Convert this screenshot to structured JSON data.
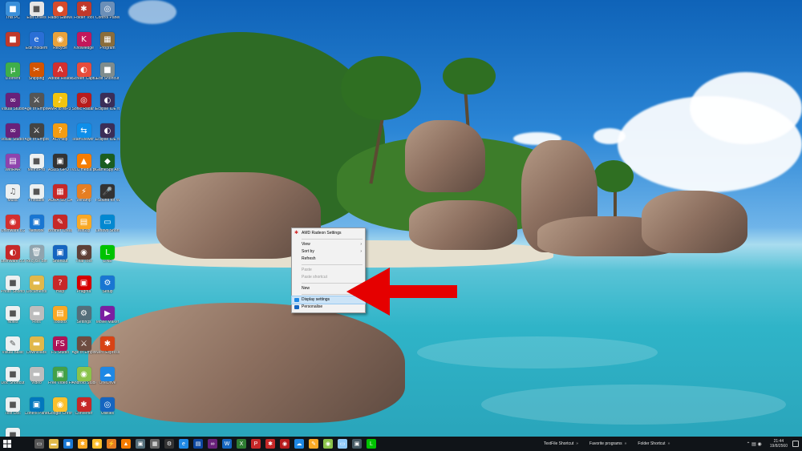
{
  "desktop": {
    "icons": [
      {
        "label": "This PC",
        "color": "#3a8fd9",
        "glyph": "■"
      },
      {
        "label": "Edit Drives",
        "color": "#e6e6e6",
        "glyph": "■"
      },
      {
        "label": "Radio Gateway",
        "color": "#d74b2c",
        "glyph": "●"
      },
      {
        "label": "Folder Tool",
        "color": "#c0392b",
        "glyph": "✱"
      },
      {
        "label": "Control Panel",
        "color": "#6b8fb8",
        "glyph": "◎"
      },
      {
        "label": "",
        "color": "#c0392b",
        "glyph": "■"
      },
      {
        "label": "Edit Holdem",
        "color": "#2a6fd6",
        "glyph": "e"
      },
      {
        "label": "Recycle",
        "color": "#e9a23b",
        "glyph": "◉"
      },
      {
        "label": "Knowledge",
        "color": "#c2185b",
        "glyph": "K"
      },
      {
        "label": "Program",
        "color": "#8a6d3b",
        "glyph": "▦"
      },
      {
        "label": "uTorrent",
        "color": "#3fae49",
        "glyph": "µ"
      },
      {
        "label": "Snipping",
        "color": "#d35400",
        "glyph": "✂"
      },
      {
        "label": "Adobe Reader XI",
        "color": "#d32f2f",
        "glyph": "A"
      },
      {
        "label": "Screen Capture",
        "color": "#e74c3c",
        "glyph": "◐"
      },
      {
        "label": "Edit Shortcut",
        "color": "#7f8c8d",
        "glyph": "■"
      },
      {
        "label": "Visual Studio",
        "color": "#68217a",
        "glyph": "∞"
      },
      {
        "label": "Age of Empires II",
        "color": "#555",
        "glyph": "⚔"
      },
      {
        "label": "AMR to MP3 Converter",
        "color": "#f1c40f",
        "glyph": "♪"
      },
      {
        "label": "Sonic Radar II",
        "color": "#b71c1c",
        "glyph": "◎"
      },
      {
        "label": "Eclipse IDE for Java",
        "color": "#3b2e58",
        "glyph": "◐"
      },
      {
        "label": "Visual Studio 2015",
        "color": "#68217a",
        "glyph": "∞"
      },
      {
        "label": "Age of Empires III",
        "color": "#444",
        "glyph": "⚔"
      },
      {
        "label": "AO Help",
        "color": "#f39c12",
        "glyph": "?"
      },
      {
        "label": "TeamViewer 12",
        "color": "#0e8ee9",
        "glyph": "⇆"
      },
      {
        "label": "Eclipse IDE for Java Dev",
        "color": "#3b2e58",
        "glyph": "◐"
      },
      {
        "label": "WinRAR",
        "color": "#8e44ad",
        "glyph": "▤"
      },
      {
        "label": "MemoPro",
        "color": "#ecf0f1",
        "glyph": "■"
      },
      {
        "label": "ASUS GPU Tweak",
        "color": "#333",
        "glyph": "▣"
      },
      {
        "label": "VLC media player",
        "color": "#f57c00",
        "glyph": "▲"
      },
      {
        "label": "GameSpy Arcade",
        "color": "#1b5e20",
        "glyph": "◆"
      },
      {
        "label": "Music",
        "color": "#ecf0f1",
        "glyph": "♫"
      },
      {
        "label": "Printable",
        "color": "#ecf0f1",
        "glyph": "■"
      },
      {
        "label": "AURA SD CARD",
        "color": "#c62828",
        "glyph": "▦"
      },
      {
        "label": "Winamp",
        "color": "#e67e22",
        "glyph": "⚡"
      },
      {
        "label": "i-Sound for Windows 7",
        "color": "#333",
        "glyph": "🎤"
      },
      {
        "label": "Unimware 8.2",
        "color": "#d32f2f",
        "glyph": "◉"
      },
      {
        "label": "Network",
        "color": "#1976d2",
        "glyph": "▣"
      },
      {
        "label": "Brother Creative",
        "color": "#c62828",
        "glyph": "✎"
      },
      {
        "label": "WinZip",
        "color": "#f9a825",
        "glyph": "▤"
      },
      {
        "label": "Lenovo Shortcut",
        "color": "#0288d1",
        "glyph": "▭"
      },
      {
        "label": "unimware 8.99 My Program",
        "color": "#c62828",
        "glyph": "◐"
      },
      {
        "label": "Recycle Bin",
        "color": "#90a4ae",
        "glyph": "🗑"
      },
      {
        "label": "Shortcut",
        "color": "#1565c0",
        "glyph": "▣"
      },
      {
        "label": "Thai Tool",
        "color": "#5d4037",
        "glyph": "◉"
      },
      {
        "label": "LINE",
        "color": "#00c300",
        "glyph": "L"
      },
      {
        "label": "Photo Shortcut 4K",
        "color": "#ecf0f1",
        "glyph": "■"
      },
      {
        "label": "Documents",
        "color": "#e0b84a",
        "glyph": "▬"
      },
      {
        "label": "Help",
        "color": "#c62828",
        "glyph": "?"
      },
      {
        "label": "Pragma",
        "color": "#d50000",
        "glyph": "▣"
      },
      {
        "label": "Setup",
        "color": "#1976d2",
        "glyph": "⚙"
      },
      {
        "label": "Notes",
        "color": "#ecf0f1",
        "glyph": "■"
      },
      {
        "label": "Files",
        "color": "#bdbdbd",
        "glyph": "▬"
      },
      {
        "label": "Toolbox",
        "color": "#f9a825",
        "glyph": "▤"
      },
      {
        "label": "Settings",
        "color": "#546e7a",
        "glyph": "⚙"
      },
      {
        "label": "Movie Maker",
        "color": "#7b1fa2",
        "glyph": "▶"
      },
      {
        "label": "Visual Basic",
        "color": "#ecf0f1",
        "glyph": "✎"
      },
      {
        "label": "Downloads",
        "color": "#e0b84a",
        "glyph": "▬"
      },
      {
        "label": "FS Studio",
        "color": "#ad1457",
        "glyph": "FS"
      },
      {
        "label": "Age of Empires",
        "color": "#6d4c41",
        "glyph": "⚔"
      },
      {
        "label": "Nero Express",
        "color": "#d84315",
        "glyph": "✱"
      },
      {
        "label": "Doc Shortcut",
        "color": "#ecf0f1",
        "glyph": "■"
      },
      {
        "label": "Video",
        "color": "#bdbdbd",
        "glyph": "▬"
      },
      {
        "label": "Free Video Flip and Rotate",
        "color": "#43a047",
        "glyph": "▣"
      },
      {
        "label": "Android Studio",
        "color": "#8bc34a",
        "glyph": "◉"
      },
      {
        "label": "OneDrive",
        "color": "#1e88e5",
        "glyph": "☁"
      },
      {
        "label": "Text Doc",
        "color": "#ecf0f1",
        "glyph": "■"
      },
      {
        "label": "Control Panel",
        "color": "#0277bd",
        "glyph": "▣"
      },
      {
        "label": "Google Chrome",
        "color": "#fbc02d",
        "glyph": "◉"
      },
      {
        "label": "Converter",
        "color": "#c62828",
        "glyph": "✱"
      },
      {
        "label": "Utilities",
        "color": "#1565c0",
        "glyph": "◎"
      },
      {
        "label": "Folder Shortcut",
        "color": "#ecf0f1",
        "glyph": "■"
      }
    ]
  },
  "context_menu": {
    "header": {
      "label": "AMD Radeon Settings",
      "icon": "amd-radeon-icon",
      "color": "#d32f2f"
    },
    "items": [
      {
        "label": "View",
        "submenu": true,
        "disabled": false
      },
      {
        "label": "Sort by",
        "submenu": true,
        "disabled": false
      },
      {
        "label": "Refresh",
        "submenu": false,
        "disabled": false
      }
    ],
    "clipboard": [
      {
        "label": "Paste",
        "disabled": true
      },
      {
        "label": "Paste shortcut",
        "disabled": true
      }
    ],
    "new_item": {
      "label": "New",
      "submenu": true
    },
    "display": [
      {
        "label": "Display settings",
        "icon": "display-icon",
        "selected": true,
        "color": "#1e88e5"
      },
      {
        "label": "Personalise",
        "icon": "personalise-icon",
        "selected": false,
        "color": "#1565c0"
      }
    ],
    "arrow_glyph": "›"
  },
  "annotation": {
    "color": "#e50000"
  },
  "taskbar": {
    "start_icon": "windows-start-icon",
    "pinned": [
      {
        "name": "task-view-icon",
        "glyph": "▭",
        "color": "#555"
      },
      {
        "name": "file-explorer-icon",
        "glyph": "▬",
        "color": "#e0b84a"
      },
      {
        "name": "store-icon",
        "glyph": "◼",
        "color": "#1976d2"
      },
      {
        "name": "photos-icon",
        "glyph": "✱",
        "color": "#f9a825"
      },
      {
        "name": "chrome-icon",
        "glyph": "◉",
        "color": "#fbc02d"
      },
      {
        "name": "winamp-icon",
        "glyph": "⚡",
        "color": "#e67e22"
      },
      {
        "name": "vlc-icon",
        "glyph": "▲",
        "color": "#f57c00"
      },
      {
        "name": "video-icon",
        "glyph": "▣",
        "color": "#546e7a"
      },
      {
        "name": "calculator-icon",
        "glyph": "▦",
        "color": "#666"
      },
      {
        "name": "settings-icon",
        "glyph": "⚙",
        "color": "#333"
      },
      {
        "name": "edge-icon",
        "glyph": "e",
        "color": "#1e88e5"
      },
      {
        "name": "mail-icon",
        "glyph": "▤",
        "color": "#0d47a1"
      },
      {
        "name": "visual-studio-icon",
        "glyph": "∞",
        "color": "#68217a"
      },
      {
        "name": "word-icon",
        "glyph": "W",
        "color": "#1565c0"
      },
      {
        "name": "excel-icon",
        "glyph": "X",
        "color": "#2e7d32"
      },
      {
        "name": "powerpoint-icon",
        "glyph": "P",
        "color": "#c62828"
      },
      {
        "name": "amd-icon",
        "glyph": "✱",
        "color": "#c62828"
      },
      {
        "name": "radeon-icon",
        "glyph": "◉",
        "color": "#b71c1c"
      },
      {
        "name": "onedrive-icon",
        "glyph": "☁",
        "color": "#1e88e5"
      },
      {
        "name": "maps-icon",
        "glyph": "✎",
        "color": "#f9a825"
      },
      {
        "name": "android-studio-icon",
        "glyph": "◉",
        "color": "#8bc34a"
      },
      {
        "name": "notepad-icon",
        "glyph": "▭",
        "color": "#90caf9"
      },
      {
        "name": "monitor-icon",
        "glyph": "▣",
        "color": "#455a64"
      },
      {
        "name": "line-icon",
        "glyph": "L",
        "color": "#00c300"
      }
    ],
    "toolbars": [
      {
        "label": "TextFile Shortcut"
      },
      {
        "label": "Favorite programs"
      },
      {
        "label": "Folder Shortcut"
      }
    ],
    "toolbar_chevron": "»",
    "tray_glyphs": "⌃ ▤ ◉",
    "clock": {
      "time": "21:44",
      "date": "19/8/2560"
    }
  }
}
